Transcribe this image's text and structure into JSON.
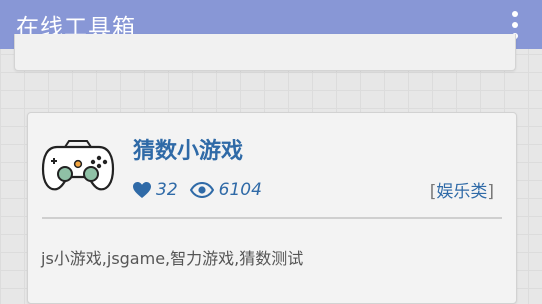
{
  "app": {
    "title": "在线工具箱",
    "menu_icon": "more-vertical-icon"
  },
  "colors": {
    "appbar": "#8897d6",
    "accent": "#2f6aa7",
    "text_muted": "#555555"
  },
  "card": {
    "icon": "gamepad-icon",
    "title": "猜数小游戏",
    "likes": "32",
    "views": "6104",
    "category_open": "[",
    "category": "娱乐类",
    "category_close": "]",
    "tags": "js小游戏,jsgame,智力游戏,猜数测试"
  }
}
